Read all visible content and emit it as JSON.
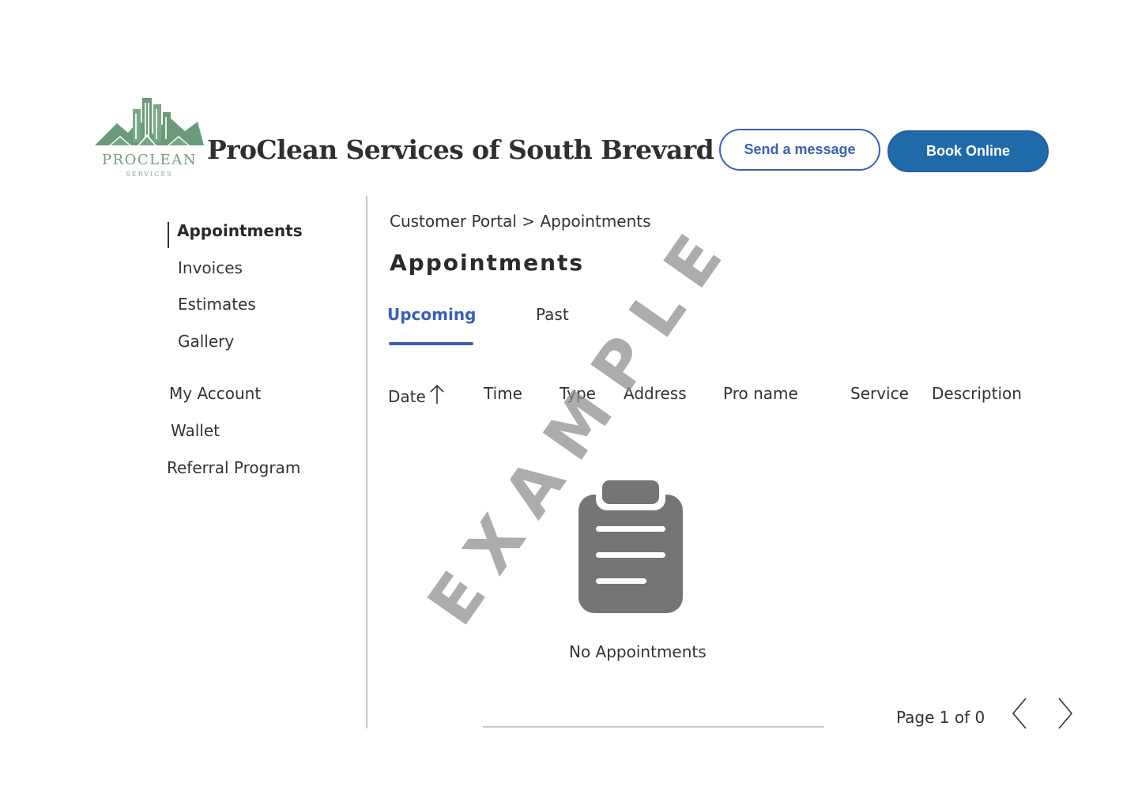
{
  "header": {
    "logo_text": "PROCLEAN",
    "logo_subtext": "SERVICES",
    "company_name": "ProClean Services of South Brevard",
    "send_message_label": "Send a message",
    "book_online_label": "Book Online"
  },
  "sidebar": {
    "items": [
      {
        "label": "Appointments",
        "active": true
      },
      {
        "label": "Invoices"
      },
      {
        "label": "Estimates"
      },
      {
        "label": "Gallery"
      },
      {
        "label": "My Account"
      },
      {
        "label": "Wallet"
      },
      {
        "label": "Referral Program"
      }
    ]
  },
  "main": {
    "breadcrumb": "Customer Portal > Appointments",
    "title": "Appointments",
    "tabs": [
      {
        "label": "Upcoming",
        "active": true
      },
      {
        "label": "Past"
      }
    ],
    "columns": [
      "Date",
      "Time",
      "Type",
      "Address",
      "Pro name",
      "Service",
      "Description"
    ],
    "empty_message": "No Appointments",
    "pagination": {
      "label": "Page 1 of 0"
    }
  },
  "watermark": "EXAMPLE",
  "colors": {
    "accent": "#3b5fb5",
    "primary_button": "#1f6aa8",
    "logo_green": "#6a9a78",
    "icon_gray": "#757575"
  },
  "icons": {
    "logo": "building-mountain-logo",
    "sort": "arrow-up-icon",
    "empty_state": "clipboard-icon",
    "prev": "chevron-left-icon",
    "next": "chevron-right-icon"
  }
}
